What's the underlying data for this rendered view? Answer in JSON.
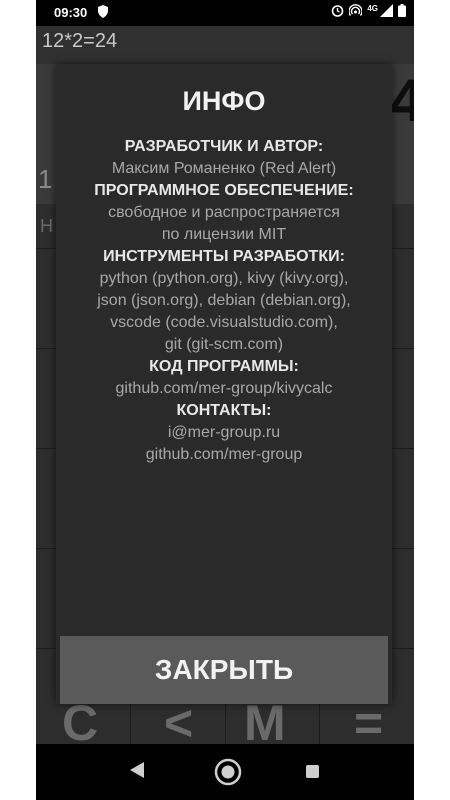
{
  "status_bar": {
    "time": "09:30",
    "network_label": "4G"
  },
  "calculator": {
    "expression": "12*2=24",
    "partial_left_digit": "1",
    "partial_right_digit": "4",
    "partial_row_label": "H",
    "partial_bottom_keys": [
      "C",
      "<",
      "M",
      "="
    ]
  },
  "dialog": {
    "title": "ИНФО",
    "lines": [
      {
        "text": "РАЗРАБОТЧИК И АВТОР:",
        "heading": true
      },
      {
        "text": "Максим Романенко (Red Alert)",
        "heading": false
      },
      {
        "text": "ПРОГРАММНОЕ ОБЕСПЕЧЕНИЕ:",
        "heading": true
      },
      {
        "text": "свободное и распространяется",
        "heading": false
      },
      {
        "text": "по лицензии MIT",
        "heading": false
      },
      {
        "text": "ИНСТРУМЕНТЫ РАЗРАБОТКИ:",
        "heading": true
      },
      {
        "text": "python (python.org), kivy (kivy.org),",
        "heading": false
      },
      {
        "text": "json (json.org), debian (debian.org),",
        "heading": false
      },
      {
        "text": "vscode (code.visualstudio.com),",
        "heading": false
      },
      {
        "text": "git (git-scm.com)",
        "heading": false
      },
      {
        "text": "КОД ПРОГРАММЫ:",
        "heading": true
      },
      {
        "text": "github.com/mer-group/kivycalc",
        "heading": false
      },
      {
        "text": "КОНТАКТЫ:",
        "heading": true
      },
      {
        "text": "i@mer-group.ru",
        "heading": false
      },
      {
        "text": "github.com/mer-group",
        "heading": false
      }
    ],
    "close_label": "ЗАКРЫТЬ"
  },
  "nav_bar": {
    "icons": [
      "back-icon",
      "home-icon",
      "recents-icon"
    ]
  }
}
